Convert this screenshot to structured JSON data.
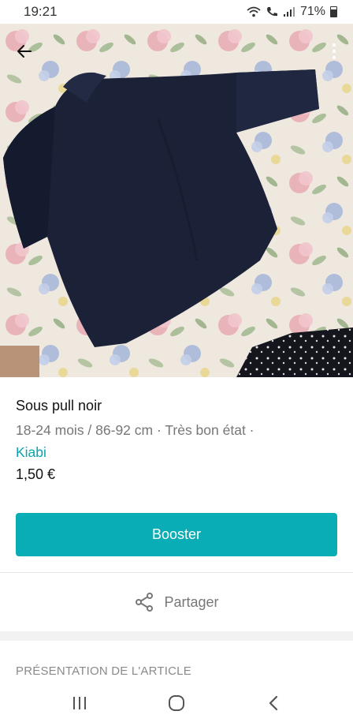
{
  "status_bar": {
    "time": "19:21",
    "battery": "71%",
    "icons": [
      "wifi-icon",
      "call-icon",
      "signal-icon",
      "battery-icon"
    ]
  },
  "header": {
    "back_icon": "arrow-left-icon",
    "more_icon": "more-vertical-icon"
  },
  "item": {
    "title": "Sous pull noir",
    "meta": "18-24 mois / 86-92 cm · Très bon état ·",
    "brand": "Kiabi",
    "price": "1,50 €"
  },
  "actions": {
    "booster_label": "Booster",
    "share_label": "Partager"
  },
  "section": {
    "presentation_title": "PRÉSENTATION DE L'ARTICLE"
  },
  "nav": {
    "icons": [
      "recent-apps-icon",
      "home-icon",
      "back-icon"
    ]
  },
  "colors": {
    "accent": "#09adb5",
    "brand_link": "#09a3ae"
  }
}
